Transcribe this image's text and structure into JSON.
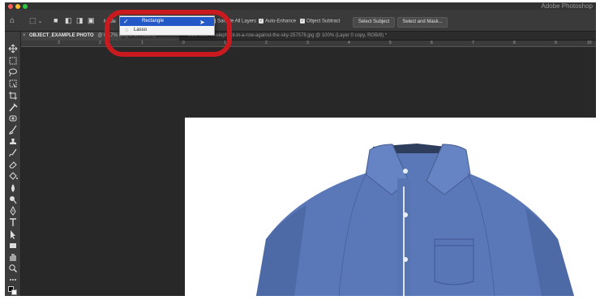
{
  "app": {
    "title": "Adobe Photoshop"
  },
  "window": {
    "traffic_colors": [
      "#ff5f57",
      "#febc2e",
      "#28c840"
    ]
  },
  "options_bar": {
    "mode_label": "Mode",
    "checkboxes": [
      {
        "label": "Sample All Layers",
        "checked": true
      },
      {
        "label": "Auto-Enhance",
        "checked": true
      },
      {
        "label": "Object Subtract",
        "checked": true
      }
    ],
    "buttons": {
      "select_subject": "Select Subject",
      "select_and_mask": "Select and Mask..."
    }
  },
  "mode_dropdown": {
    "items": [
      {
        "label": "Rectangle",
        "selected": true
      },
      {
        "label": "Lasso",
        "selected": false
      }
    ]
  },
  "tabs": {
    "active": "OBJECT_EXAMPLE PHOTO",
    "active_suffix": "@ 66.7% (Layer 1, RGB/8)",
    "inactive": "blue-view-of-elephant-in-a-row-against-the-sky-257578.jpg @ 100% (Layer 0 copy, RGB/8) *"
  },
  "ruler": {
    "labels": [
      "3",
      "2",
      "1",
      "0",
      "1",
      "2",
      "3",
      "4",
      "5",
      "6",
      "7",
      "8",
      "9",
      "10"
    ]
  },
  "document": {
    "shirt_color": "#5a78b8",
    "highlight_color": "#c81a1f"
  }
}
